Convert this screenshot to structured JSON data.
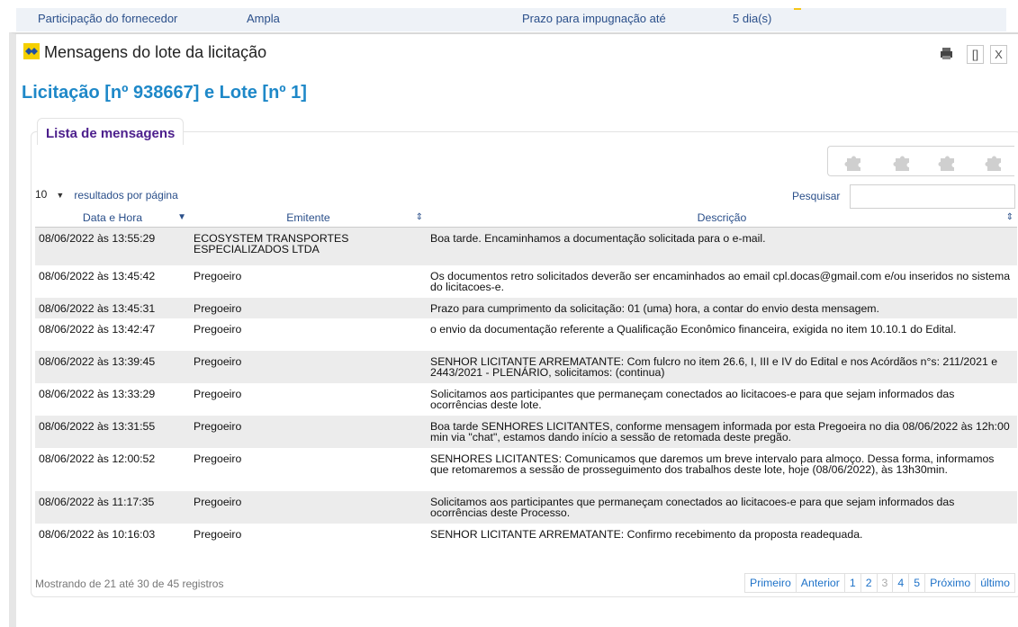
{
  "background": {
    "fields": [
      {
        "label": "Participação do fornecedor",
        "value": "Ampla"
      },
      {
        "label": "Prazo para impugnação até",
        "value": "5 dia(s)"
      }
    ]
  },
  "modal": {
    "title": "Mensagens do lote da licitação",
    "buttons": {
      "print": "print-icon",
      "maximize": "[]",
      "close": "X"
    }
  },
  "licitacao_title": "Licitação [nº 938667] e Lote [nº 1]",
  "panel": {
    "tab_label": "Lista de mensagens",
    "export_icons": [
      "puzzle-icon",
      "puzzle-icon",
      "puzzle-icon",
      "puzzle-icon"
    ],
    "page_length": {
      "value": "10",
      "label": "resultados por página"
    },
    "search": {
      "label": "Pesquisar",
      "value": "",
      "placeholder": ""
    },
    "columns": [
      "Data e Hora",
      "Emitente",
      "Descrição"
    ],
    "rows": [
      {
        "datetime": "08/06/2022 às 13:55:29",
        "emitter": "ECOSYSTEM TRANSPORTES ESPECIALIZADOS LTDA",
        "description": "Boa tarde. Encaminhamos a documentação solicitada para o e-mail."
      },
      {
        "datetime": "08/06/2022 às 13:45:42",
        "emitter": "Pregoeiro",
        "description": "Os documentos retro solicitados deverão ser encaminhados ao email cpl.docas@gmail.com e/ou inseridos no sistema do licitacoes-e."
      },
      {
        "datetime": "08/06/2022 às 13:45:31",
        "emitter": "Pregoeiro",
        "description": "Prazo para cumprimento da solicitação: 01 (uma) hora, a contar do envio desta mensagem."
      },
      {
        "datetime": "08/06/2022 às 13:42:47",
        "emitter": "Pregoeiro",
        "description": "o envio da documentação referente a Qualificação Econômico financeira, exigida no item 10.10.1 do Edital."
      },
      {
        "datetime": "08/06/2022 às 13:39:45",
        "emitter": "Pregoeiro",
        "description": "SENHOR LICITANTE ARREMATANTE: Com fulcro no item 26.6, I, III e IV do Edital e nos Acórdãos n°s: 211/2021 e 2443/2021 - PLENÁRIO, solicitamos: (continua)"
      },
      {
        "datetime": "08/06/2022 às 13:33:29",
        "emitter": "Pregoeiro",
        "description": "Solicitamos aos participantes que permaneçam conectados ao licitacoes-e para que sejam informados das ocorrências deste lote."
      },
      {
        "datetime": "08/06/2022 às 13:31:55",
        "emitter": "Pregoeiro",
        "description": "Boa tarde SENHORES LICITANTES, conforme mensagem informada por esta Pregoeira no dia 08/06/2022 às 12h:00 min via \"chat\", estamos dando início a sessão de retomada deste pregão."
      },
      {
        "datetime": "08/06/2022 às 12:00:52",
        "emitter": "Pregoeiro",
        "description": "SENHORES LICITANTES: Comunicamos que daremos um breve intervalo para almoço. Dessa forma, informamos que retomaremos a sessão de prosseguimento dos trabalhos deste lote, hoje (08/06/2022), às 13h30min."
      },
      {
        "datetime": "08/06/2022 às 11:17:35",
        "emitter": "Pregoeiro",
        "description": "Solicitamos aos participantes que permaneçam conectados ao licitacoes-e para que sejam informados das ocorrências deste Processo."
      },
      {
        "datetime": "08/06/2022 às 10:16:03",
        "emitter": "Pregoeiro",
        "description": "SENHOR LICITANTE ARREMATANTE: Confirmo recebimento da proposta readequada."
      }
    ],
    "info": "Mostrando de 21 até 30 de 45 registros",
    "pagination": {
      "first": "Primeiro",
      "previous": "Anterior",
      "pages": [
        "1",
        "2",
        "3",
        "4",
        "5"
      ],
      "current_page": "3",
      "next": "Próximo",
      "last": "último"
    }
  },
  "colors": {
    "title_blue": "#1e88c8",
    "tab_purple": "#4c1f8c",
    "link_blue": "#1e72c8",
    "row_stripe": "#ececec"
  }
}
